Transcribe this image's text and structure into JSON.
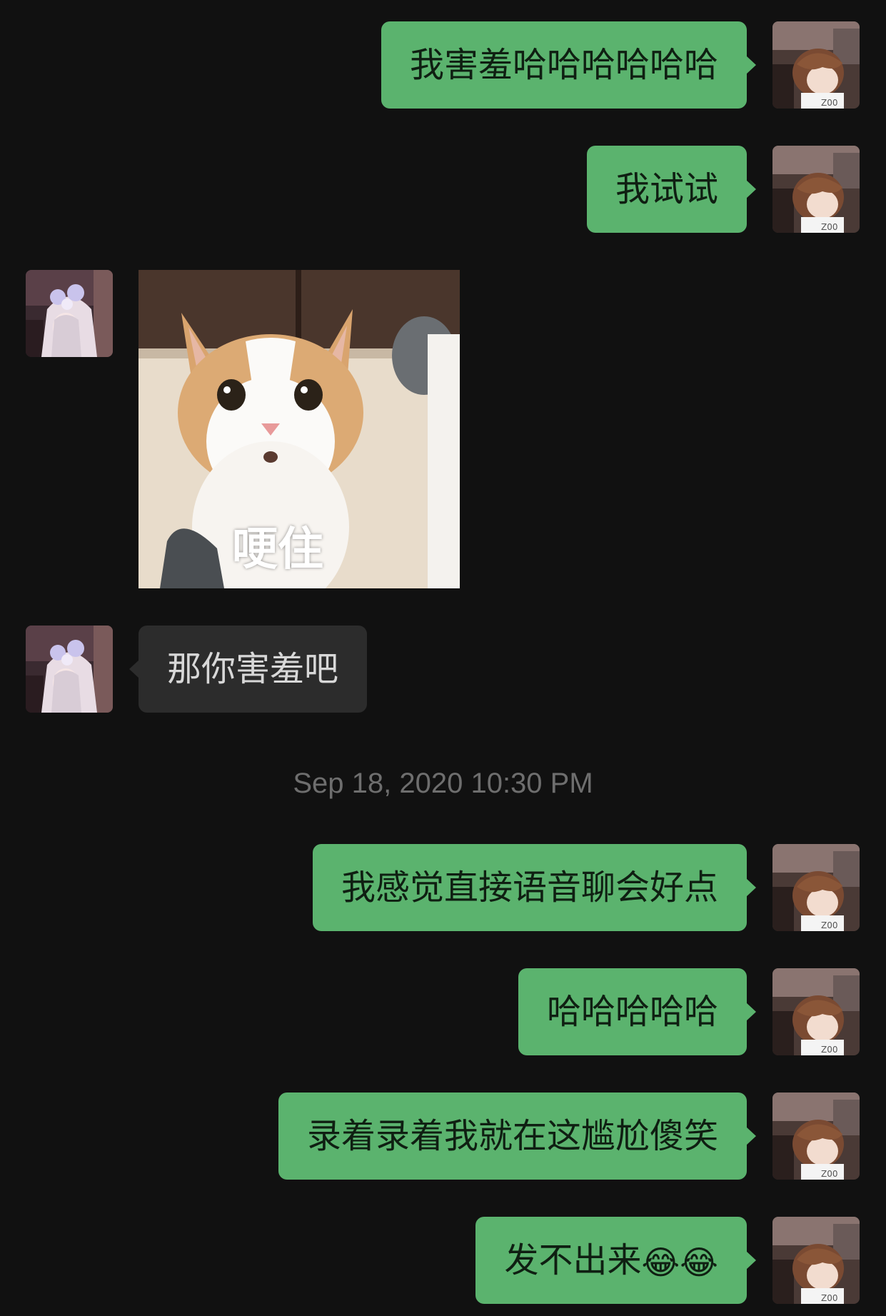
{
  "colors": {
    "background": "#111111",
    "outgoing_bubble": "#5bb36e",
    "incoming_bubble": "#2c2c2c",
    "timestamp_text": "#6e6e6e"
  },
  "messages": [
    {
      "direction": "out",
      "type": "text",
      "text": "我害羞哈哈哈哈哈哈"
    },
    {
      "direction": "out",
      "type": "text",
      "text": "我试试"
    },
    {
      "direction": "in",
      "type": "sticker",
      "caption": "哽住",
      "icon": "cat-sticker-image"
    },
    {
      "direction": "in",
      "type": "text",
      "text": "那你害羞吧"
    },
    {
      "direction": "out",
      "type": "text",
      "text": "我感觉直接语音聊会好点"
    },
    {
      "direction": "out",
      "type": "text",
      "text": "哈哈哈哈哈"
    },
    {
      "direction": "out",
      "type": "text",
      "text": "录着录着我就在这尴尬傻笑"
    },
    {
      "direction": "out",
      "type": "text",
      "text": "发不出来",
      "emojis": [
        "😂",
        "😂"
      ]
    }
  ],
  "timestamp": "Sep 18, 2020 10:30 PM",
  "avatars": {
    "self": "anime-boy-avatar",
    "other": "anime-girl-avatar"
  }
}
